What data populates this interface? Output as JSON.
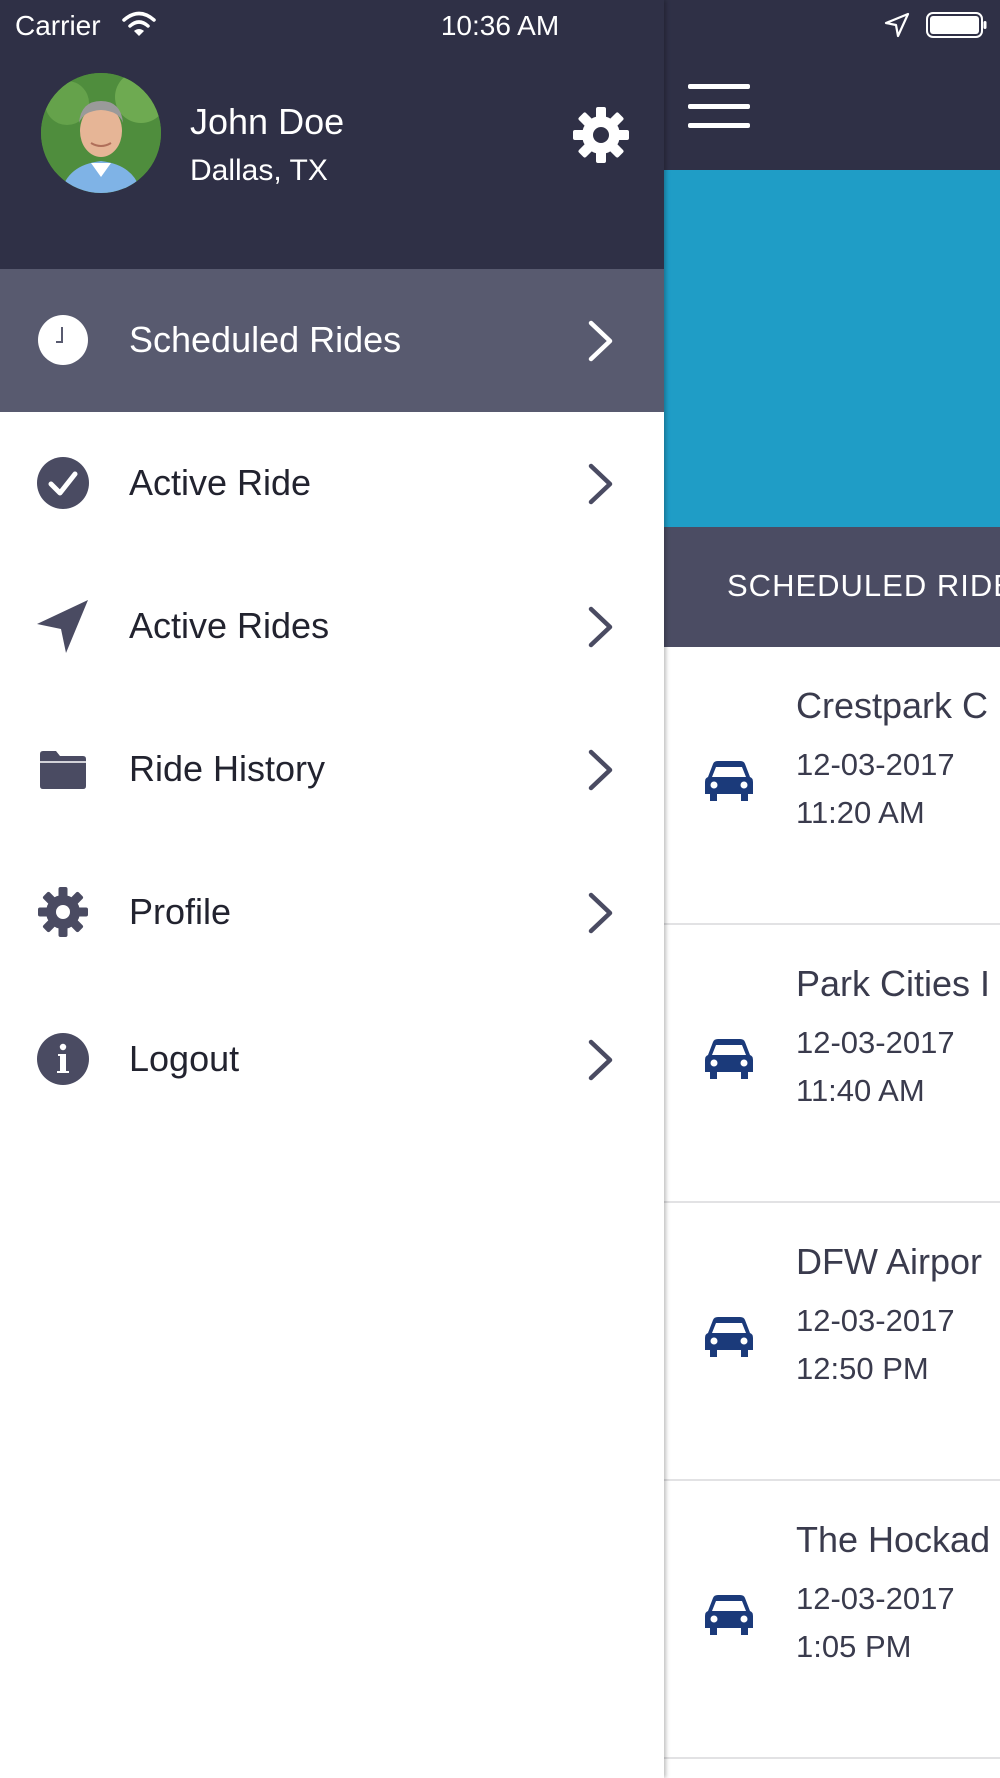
{
  "status_bar": {
    "carrier": "Carrier",
    "time": "10:36 AM"
  },
  "profile": {
    "name": "John Doe",
    "location": "Dallas, TX"
  },
  "menu": {
    "items": [
      {
        "label": "Scheduled Rides",
        "icon": "clock-icon",
        "active": true
      },
      {
        "label": "Active Ride",
        "icon": "check-circle-icon",
        "active": false
      },
      {
        "label": "Active Rides",
        "icon": "navigation-arrow-icon",
        "active": false
      },
      {
        "label": "Ride History",
        "icon": "folder-icon",
        "active": false
      },
      {
        "label": "Profile",
        "icon": "gear-icon",
        "active": false
      },
      {
        "label": "Logout",
        "icon": "info-icon",
        "active": false
      }
    ]
  },
  "screen": {
    "section_title": "SCHEDULED RIDE",
    "rides": [
      {
        "name": "Crestpark C",
        "date": "12-03-2017",
        "time": "11:20 AM"
      },
      {
        "name": "Park Cities I",
        "date": "12-03-2017",
        "time": "11:40 AM"
      },
      {
        "name": "DFW Airpor",
        "date": "12-03-2017",
        "time": "12:50 PM"
      },
      {
        "name": "The Hockad",
        "date": "12-03-2017",
        "time": "1:05 PM"
      }
    ]
  },
  "colors": {
    "header_bg": "#2f3046",
    "active_item_bg": "#585a6f",
    "hero_blue": "#1f9dc6",
    "section_bar": "#4b4c63",
    "car_icon": "#1b3a7a",
    "menu_icon": "#4a4b62"
  }
}
